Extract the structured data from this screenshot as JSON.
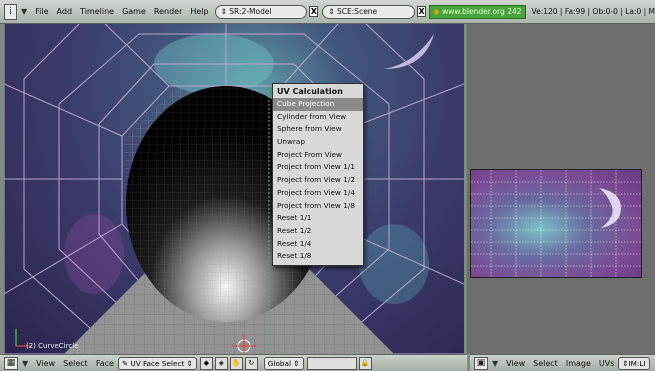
{
  "topbar": {
    "menus": [
      "File",
      "Add",
      "Timeline",
      "Game",
      "Render",
      "Help"
    ],
    "screen_field": "SR:2-Model",
    "scene_field": "SCE:Scene",
    "url": "www.blender.org 242",
    "stats": "Ve:120 | Fa:99 | Ob:0-0 | La:0 | M"
  },
  "viewport": {
    "object_label": "(2) CurveCircle"
  },
  "uv_menu": {
    "title": "UV Calculation",
    "items": [
      "Cube Projection",
      "Cylinder from View",
      "Sphere from View",
      "Unwrap",
      "Project From View",
      "Project from View 1/1",
      "Project from View 1/2",
      "Project from View 1/4",
      "Project from View 1/8",
      "Reset 1/1",
      "Reset 1/2",
      "Reset 1/4",
      "Reset 1/8"
    ],
    "active_index": 0
  },
  "bottom_left": {
    "view": "View",
    "select": "Select",
    "face": "Face",
    "mode": "UV Face Select",
    "global": "Global"
  },
  "bottom_right": {
    "view": "View",
    "select": "Select",
    "image": "Image",
    "uvs": "UVs",
    "image_field": "IM:LI"
  },
  "colors": {
    "menu_active": "#8a8a8a",
    "url_green": "#49a33c"
  }
}
